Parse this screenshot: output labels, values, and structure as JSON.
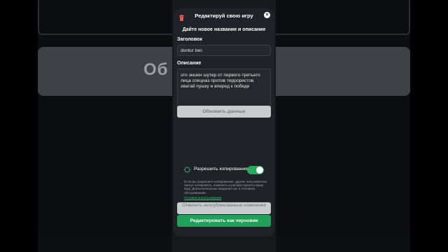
{
  "background": {
    "card_text": "Об         ые"
  },
  "modal": {
    "title": "Редактируй свою игру",
    "close_glyph": "×",
    "section_heading": "Дайте новое название и описание",
    "title_label": "Заголовок",
    "title_value": "dontur two",
    "description_label": "Описание",
    "description_value": "это экшен шутер от первого-третьего лица спецназ против террористов хватай пушку и вперед к победе",
    "update_button": "Обновить данные",
    "copy_label": "Разрешить копирование",
    "copy_enabled": true,
    "copy_note": "Если вы разрешите копирование, другие пользователи смогут копировать, изменять и распространять вашу игру. Дополнительные сведения см. в Условиях обслуживания.",
    "terms_link": "Условия использования",
    "discard_button": "Отменить неопубликованные изменения",
    "save_draft_button": "Редактировать как черновик"
  },
  "colors": {
    "accent_green": "#21a05a",
    "trash_red": "#e35b50"
  }
}
